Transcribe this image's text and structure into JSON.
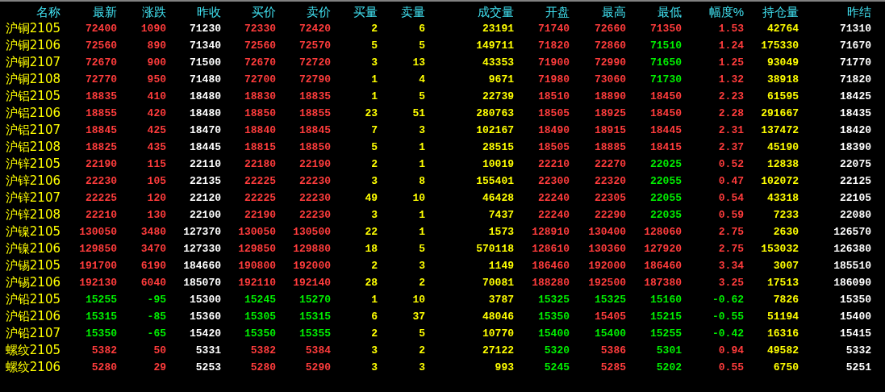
{
  "columns": [
    {
      "label": "名称",
      "kind": "name"
    },
    {
      "label": "最新",
      "kind": "trend"
    },
    {
      "label": "涨跌",
      "kind": "trend"
    },
    {
      "label": "昨收",
      "kind": "plain"
    },
    {
      "label": "买价",
      "kind": "trend"
    },
    {
      "label": "卖价",
      "kind": "trend"
    },
    {
      "label": "买量",
      "kind": "volume"
    },
    {
      "label": "卖量",
      "kind": "volume"
    },
    {
      "label": "成交量",
      "kind": "volume"
    },
    {
      "label": "开盘",
      "kind": "trend"
    },
    {
      "label": "最高",
      "kind": "trend"
    },
    {
      "label": "最低",
      "kind": "trend"
    },
    {
      "label": "幅度%",
      "kind": "trend"
    },
    {
      "label": "持仓量",
      "kind": "volume"
    },
    {
      "label": "昨结",
      "kind": "plain"
    }
  ],
  "rows": [
    {
      "cells": [
        {
          "text": "沪铜2105"
        },
        {
          "text": "72400",
          "rising": true
        },
        {
          "text": "1090",
          "rising": true
        },
        {
          "text": "71230"
        },
        {
          "text": "72330",
          "rising": true
        },
        {
          "text": "72420",
          "rising": true
        },
        {
          "text": "2"
        },
        {
          "text": "6"
        },
        {
          "text": "23191"
        },
        {
          "text": "71740",
          "rising": true
        },
        {
          "text": "72660",
          "rising": true
        },
        {
          "text": "71350",
          "rising": true
        },
        {
          "text": "1.53",
          "rising": true
        },
        {
          "text": "42764"
        },
        {
          "text": "71310"
        }
      ]
    },
    {
      "cells": [
        {
          "text": "沪铜2106"
        },
        {
          "text": "72560",
          "rising": true
        },
        {
          "text": "890",
          "rising": true
        },
        {
          "text": "71340"
        },
        {
          "text": "72560",
          "rising": true
        },
        {
          "text": "72570",
          "rising": true
        },
        {
          "text": "5"
        },
        {
          "text": "5"
        },
        {
          "text": "149711"
        },
        {
          "text": "71820",
          "rising": true
        },
        {
          "text": "72860",
          "rising": true
        },
        {
          "text": "71510",
          "rising": false
        },
        {
          "text": "1.24",
          "rising": true
        },
        {
          "text": "175330"
        },
        {
          "text": "71670"
        }
      ]
    },
    {
      "cells": [
        {
          "text": "沪铜2107"
        },
        {
          "text": "72670",
          "rising": true
        },
        {
          "text": "900",
          "rising": true
        },
        {
          "text": "71500"
        },
        {
          "text": "72670",
          "rising": true
        },
        {
          "text": "72720",
          "rising": true
        },
        {
          "text": "3"
        },
        {
          "text": "13"
        },
        {
          "text": "43353"
        },
        {
          "text": "71900",
          "rising": true
        },
        {
          "text": "72990",
          "rising": true
        },
        {
          "text": "71650",
          "rising": false
        },
        {
          "text": "1.25",
          "rising": true
        },
        {
          "text": "93049"
        },
        {
          "text": "71770"
        }
      ]
    },
    {
      "cells": [
        {
          "text": "沪铜2108"
        },
        {
          "text": "72770",
          "rising": true
        },
        {
          "text": "950",
          "rising": true
        },
        {
          "text": "71480"
        },
        {
          "text": "72700",
          "rising": true
        },
        {
          "text": "72790",
          "rising": true
        },
        {
          "text": "1"
        },
        {
          "text": "4"
        },
        {
          "text": "9671"
        },
        {
          "text": "71980",
          "rising": true
        },
        {
          "text": "73060",
          "rising": true
        },
        {
          "text": "71730",
          "rising": false
        },
        {
          "text": "1.32",
          "rising": true
        },
        {
          "text": "38918"
        },
        {
          "text": "71820"
        }
      ]
    },
    {
      "cells": [
        {
          "text": "沪铝2105"
        },
        {
          "text": "18835",
          "rising": true
        },
        {
          "text": "410",
          "rising": true
        },
        {
          "text": "18480"
        },
        {
          "text": "18830",
          "rising": true
        },
        {
          "text": "18835",
          "rising": true
        },
        {
          "text": "1"
        },
        {
          "text": "5"
        },
        {
          "text": "22739"
        },
        {
          "text": "18510",
          "rising": true
        },
        {
          "text": "18890",
          "rising": true
        },
        {
          "text": "18450",
          "rising": true
        },
        {
          "text": "2.23",
          "rising": true
        },
        {
          "text": "61595"
        },
        {
          "text": "18425"
        }
      ]
    },
    {
      "cells": [
        {
          "text": "沪铝2106"
        },
        {
          "text": "18855",
          "rising": true
        },
        {
          "text": "420",
          "rising": true
        },
        {
          "text": "18480"
        },
        {
          "text": "18850",
          "rising": true
        },
        {
          "text": "18855",
          "rising": true
        },
        {
          "text": "23"
        },
        {
          "text": "51"
        },
        {
          "text": "280763"
        },
        {
          "text": "18505",
          "rising": true
        },
        {
          "text": "18925",
          "rising": true
        },
        {
          "text": "18450",
          "rising": true
        },
        {
          "text": "2.28",
          "rising": true
        },
        {
          "text": "291667"
        },
        {
          "text": "18435"
        }
      ]
    },
    {
      "cells": [
        {
          "text": "沪铝2107"
        },
        {
          "text": "18845",
          "rising": true
        },
        {
          "text": "425",
          "rising": true
        },
        {
          "text": "18470"
        },
        {
          "text": "18840",
          "rising": true
        },
        {
          "text": "18845",
          "rising": true
        },
        {
          "text": "7"
        },
        {
          "text": "3"
        },
        {
          "text": "102167"
        },
        {
          "text": "18490",
          "rising": true
        },
        {
          "text": "18915",
          "rising": true
        },
        {
          "text": "18445",
          "rising": true
        },
        {
          "text": "2.31",
          "rising": true
        },
        {
          "text": "137472"
        },
        {
          "text": "18420"
        }
      ]
    },
    {
      "cells": [
        {
          "text": "沪铝2108"
        },
        {
          "text": "18825",
          "rising": true
        },
        {
          "text": "435",
          "rising": true
        },
        {
          "text": "18445"
        },
        {
          "text": "18815",
          "rising": true
        },
        {
          "text": "18850",
          "rising": true
        },
        {
          "text": "5"
        },
        {
          "text": "1"
        },
        {
          "text": "28515"
        },
        {
          "text": "18505",
          "rising": true
        },
        {
          "text": "18885",
          "rising": true
        },
        {
          "text": "18415",
          "rising": true
        },
        {
          "text": "2.37",
          "rising": true
        },
        {
          "text": "45190"
        },
        {
          "text": "18390"
        }
      ]
    },
    {
      "cells": [
        {
          "text": "沪锌2105"
        },
        {
          "text": "22190",
          "rising": true
        },
        {
          "text": "115",
          "rising": true
        },
        {
          "text": "22110"
        },
        {
          "text": "22180",
          "rising": true
        },
        {
          "text": "22190",
          "rising": true
        },
        {
          "text": "2"
        },
        {
          "text": "1"
        },
        {
          "text": "10019"
        },
        {
          "text": "22210",
          "rising": true
        },
        {
          "text": "22270",
          "rising": true
        },
        {
          "text": "22025",
          "rising": false
        },
        {
          "text": "0.52",
          "rising": true
        },
        {
          "text": "12838"
        },
        {
          "text": "22075"
        }
      ]
    },
    {
      "cells": [
        {
          "text": "沪锌2106"
        },
        {
          "text": "22230",
          "rising": true
        },
        {
          "text": "105",
          "rising": true
        },
        {
          "text": "22135"
        },
        {
          "text": "22225",
          "rising": true
        },
        {
          "text": "22230",
          "rising": true
        },
        {
          "text": "3"
        },
        {
          "text": "8"
        },
        {
          "text": "155401"
        },
        {
          "text": "22300",
          "rising": true
        },
        {
          "text": "22320",
          "rising": true
        },
        {
          "text": "22055",
          "rising": false
        },
        {
          "text": "0.47",
          "rising": true
        },
        {
          "text": "102072"
        },
        {
          "text": "22125"
        }
      ]
    },
    {
      "cells": [
        {
          "text": "沪锌2107"
        },
        {
          "text": "22225",
          "rising": true
        },
        {
          "text": "120",
          "rising": true
        },
        {
          "text": "22120"
        },
        {
          "text": "22225",
          "rising": true
        },
        {
          "text": "22230",
          "rising": true
        },
        {
          "text": "49"
        },
        {
          "text": "10"
        },
        {
          "text": "46428"
        },
        {
          "text": "22240",
          "rising": true
        },
        {
          "text": "22305",
          "rising": true
        },
        {
          "text": "22055",
          "rising": false
        },
        {
          "text": "0.54",
          "rising": true
        },
        {
          "text": "43318"
        },
        {
          "text": "22105"
        }
      ]
    },
    {
      "cells": [
        {
          "text": "沪锌2108"
        },
        {
          "text": "22210",
          "rising": true
        },
        {
          "text": "130",
          "rising": true
        },
        {
          "text": "22100"
        },
        {
          "text": "22190",
          "rising": true
        },
        {
          "text": "22230",
          "rising": true
        },
        {
          "text": "3"
        },
        {
          "text": "1"
        },
        {
          "text": "7437"
        },
        {
          "text": "22240",
          "rising": true
        },
        {
          "text": "22290",
          "rising": true
        },
        {
          "text": "22035",
          "rising": false
        },
        {
          "text": "0.59",
          "rising": true
        },
        {
          "text": "7233"
        },
        {
          "text": "22080"
        }
      ]
    },
    {
      "cells": [
        {
          "text": "沪镍2105"
        },
        {
          "text": "130050",
          "rising": true
        },
        {
          "text": "3480",
          "rising": true
        },
        {
          "text": "127370"
        },
        {
          "text": "130050",
          "rising": true
        },
        {
          "text": "130500",
          "rising": true
        },
        {
          "text": "22"
        },
        {
          "text": "1"
        },
        {
          "text": "1573"
        },
        {
          "text": "128910",
          "rising": true
        },
        {
          "text": "130400",
          "rising": true
        },
        {
          "text": "128060",
          "rising": true
        },
        {
          "text": "2.75",
          "rising": true
        },
        {
          "text": "2630"
        },
        {
          "text": "126570"
        }
      ]
    },
    {
      "cells": [
        {
          "text": "沪镍2106"
        },
        {
          "text": "129850",
          "rising": true
        },
        {
          "text": "3470",
          "rising": true
        },
        {
          "text": "127330"
        },
        {
          "text": "129850",
          "rising": true
        },
        {
          "text": "129880",
          "rising": true
        },
        {
          "text": "18"
        },
        {
          "text": "5"
        },
        {
          "text": "570118"
        },
        {
          "text": "128610",
          "rising": true
        },
        {
          "text": "130360",
          "rising": true
        },
        {
          "text": "127920",
          "rising": true
        },
        {
          "text": "2.75",
          "rising": true
        },
        {
          "text": "153032"
        },
        {
          "text": "126380"
        }
      ]
    },
    {
      "cells": [
        {
          "text": "沪锡2105"
        },
        {
          "text": "191700",
          "rising": true
        },
        {
          "text": "6190",
          "rising": true
        },
        {
          "text": "184660"
        },
        {
          "text": "190800",
          "rising": true
        },
        {
          "text": "192000",
          "rising": true
        },
        {
          "text": "2"
        },
        {
          "text": "3"
        },
        {
          "text": "1149"
        },
        {
          "text": "186460",
          "rising": true
        },
        {
          "text": "192000",
          "rising": true
        },
        {
          "text": "186460",
          "rising": true
        },
        {
          "text": "3.34",
          "rising": true
        },
        {
          "text": "3007"
        },
        {
          "text": "185510"
        }
      ]
    },
    {
      "cells": [
        {
          "text": "沪锡2106"
        },
        {
          "text": "192130",
          "rising": true
        },
        {
          "text": "6040",
          "rising": true
        },
        {
          "text": "185070"
        },
        {
          "text": "192110",
          "rising": true
        },
        {
          "text": "192140",
          "rising": true
        },
        {
          "text": "28"
        },
        {
          "text": "2"
        },
        {
          "text": "70081"
        },
        {
          "text": "188280",
          "rising": true
        },
        {
          "text": "192500",
          "rising": true
        },
        {
          "text": "187380",
          "rising": true
        },
        {
          "text": "3.25",
          "rising": true
        },
        {
          "text": "17513"
        },
        {
          "text": "186090"
        }
      ]
    },
    {
      "cells": [
        {
          "text": "沪铅2105"
        },
        {
          "text": "15255",
          "rising": false
        },
        {
          "text": "-95",
          "rising": false
        },
        {
          "text": "15300"
        },
        {
          "text": "15245",
          "rising": false
        },
        {
          "text": "15270",
          "rising": false
        },
        {
          "text": "1"
        },
        {
          "text": "10"
        },
        {
          "text": "3787"
        },
        {
          "text": "15325",
          "rising": false
        },
        {
          "text": "15325",
          "rising": false
        },
        {
          "text": "15160",
          "rising": false
        },
        {
          "text": "-0.62",
          "rising": false
        },
        {
          "text": "7826"
        },
        {
          "text": "15350"
        }
      ]
    },
    {
      "cells": [
        {
          "text": "沪铅2106"
        },
        {
          "text": "15315",
          "rising": false
        },
        {
          "text": "-85",
          "rising": false
        },
        {
          "text": "15360"
        },
        {
          "text": "15305",
          "rising": false
        },
        {
          "text": "15315",
          "rising": false
        },
        {
          "text": "6"
        },
        {
          "text": "37"
        },
        {
          "text": "48046"
        },
        {
          "text": "15350",
          "rising": false
        },
        {
          "text": "15405",
          "rising": true
        },
        {
          "text": "15215",
          "rising": false
        },
        {
          "text": "-0.55",
          "rising": false
        },
        {
          "text": "51194"
        },
        {
          "text": "15400"
        }
      ]
    },
    {
      "cells": [
        {
          "text": "沪铅2107"
        },
        {
          "text": "15350",
          "rising": false
        },
        {
          "text": "-65",
          "rising": false
        },
        {
          "text": "15420"
        },
        {
          "text": "15350",
          "rising": false
        },
        {
          "text": "15355",
          "rising": false
        },
        {
          "text": "2"
        },
        {
          "text": "5"
        },
        {
          "text": "10770"
        },
        {
          "text": "15400",
          "rising": false
        },
        {
          "text": "15400",
          "rising": false
        },
        {
          "text": "15255",
          "rising": false
        },
        {
          "text": "-0.42",
          "rising": false
        },
        {
          "text": "16316"
        },
        {
          "text": "15415"
        }
      ]
    },
    {
      "cells": [
        {
          "text": "螺纹2105"
        },
        {
          "text": "5382",
          "rising": true
        },
        {
          "text": "50",
          "rising": true
        },
        {
          "text": "5331"
        },
        {
          "text": "5382",
          "rising": true
        },
        {
          "text": "5384",
          "rising": true
        },
        {
          "text": "3"
        },
        {
          "text": "2"
        },
        {
          "text": "27122"
        },
        {
          "text": "5320",
          "rising": false
        },
        {
          "text": "5386",
          "rising": true
        },
        {
          "text": "5301",
          "rising": false
        },
        {
          "text": "0.94",
          "rising": true
        },
        {
          "text": "49582"
        },
        {
          "text": "5332"
        }
      ]
    },
    {
      "cells": [
        {
          "text": "螺纹2106"
        },
        {
          "text": "5280",
          "rising": true
        },
        {
          "text": "29",
          "rising": true
        },
        {
          "text": "5253"
        },
        {
          "text": "5280",
          "rising": true
        },
        {
          "text": "5290",
          "rising": true
        },
        {
          "text": "3"
        },
        {
          "text": "3"
        },
        {
          "text": "993"
        },
        {
          "text": "5245",
          "rising": false
        },
        {
          "text": "5285",
          "rising": true
        },
        {
          "text": "5202",
          "rising": false
        },
        {
          "text": "0.55",
          "rising": true
        },
        {
          "text": "6750"
        },
        {
          "text": "5251"
        }
      ]
    }
  ]
}
